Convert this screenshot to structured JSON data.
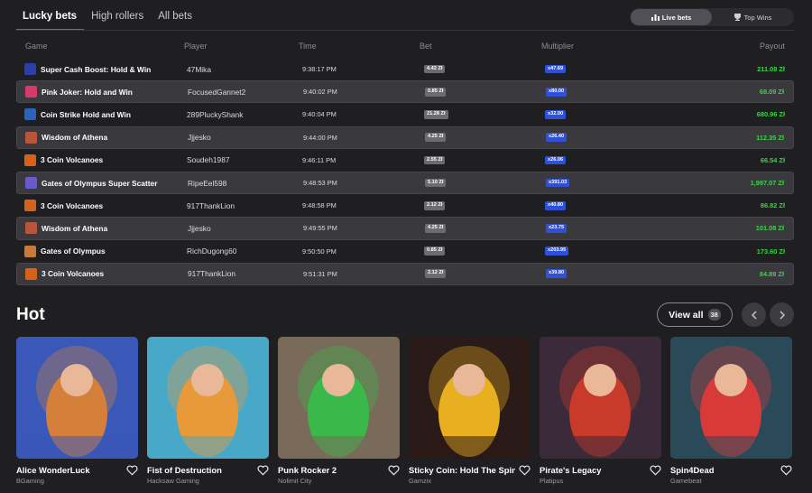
{
  "tabs": [
    "Lucky bets",
    "High rollers",
    "All bets"
  ],
  "toggle": {
    "live": "Live bets",
    "top": "Top Wins"
  },
  "columns": {
    "game": "Game",
    "player": "Player",
    "time": "Time",
    "bet": "Bet",
    "multiplier": "Multiplier",
    "payout": "Payout"
  },
  "rows": [
    {
      "game": "Super Cash Boost: Hold & Win",
      "player": "47Mika",
      "time": "9:38:17 PM",
      "bet": "4.42 Zł",
      "mult": "x47.69",
      "payout": "211.08 Zł",
      "icon_color": "#2a3fa8"
    },
    {
      "game": "Pink Joker: Hold and Win",
      "player": "FocusedGannet2",
      "time": "9:40:02 PM",
      "bet": "0.85 Zł",
      "mult": "x80.00",
      "payout": "68.09 Zł",
      "icon_color": "#d43a6a"
    },
    {
      "game": "Coin Strike Hold and Win",
      "player": "289PluckyShank",
      "time": "9:40:04 PM",
      "bet": "21.28 Zł",
      "mult": "x32.00",
      "payout": "680.96 Zł",
      "icon_color": "#2a63b8"
    },
    {
      "game": "Wisdom of Athena",
      "player": "Jjjesko",
      "time": "9:44:00 PM",
      "bet": "4.25 Zł",
      "mult": "x26.40",
      "payout": "112.35 Zł",
      "icon_color": "#b8553a"
    },
    {
      "game": "3 Coin Volcanoes",
      "player": "Soudeh1987",
      "time": "9:46:11 PM",
      "bet": "2.55 Zł",
      "mult": "x26.06",
      "payout": "66.54 Zł",
      "icon_color": "#d8611a"
    },
    {
      "game": "Gates of Olympus Super Scatter",
      "player": "RipeEel598",
      "time": "9:48:53 PM",
      "bet": "5.10 Zł",
      "mult": "x391.03",
      "payout": "1,997.07 Zł",
      "icon_color": "#6a5ac8"
    },
    {
      "game": "3 Coin Volcanoes",
      "player": "917ThankLion",
      "time": "9:48:58 PM",
      "bet": "2.12 Zł",
      "mult": "x40.80",
      "payout": "86.82 Zł",
      "icon_color": "#d8611a"
    },
    {
      "game": "Wisdom of Athena",
      "player": "Jjjesko",
      "time": "9:49:55 PM",
      "bet": "4.25 Zł",
      "mult": "x23.75",
      "payout": "101.08 Zł",
      "icon_color": "#b8553a"
    },
    {
      "game": "Gates of Olympus",
      "player": "RichDugong60",
      "time": "9:50:50 PM",
      "bet": "0.85 Zł",
      "mult": "x203.95",
      "payout": "173.60 Zł",
      "icon_color": "#c87a3a"
    },
    {
      "game": "3 Coin Volcanoes",
      "player": "917ThankLion",
      "time": "9:51:31 PM",
      "bet": "2.12 Zł",
      "mult": "x39.80",
      "payout": "84.89 Zł",
      "icon_color": "#d8611a"
    }
  ],
  "hot": {
    "title": "Hot",
    "view_all": "View all",
    "count": "38",
    "games": [
      {
        "name": "Alice WonderLuck",
        "provider": "BGaming",
        "bg": "#3a58b8",
        "accent": "#d4803a"
      },
      {
        "name": "Fist of Destruction",
        "provider": "Hacksaw Gaming",
        "bg": "#48a8c8",
        "accent": "#e89a3a"
      },
      {
        "name": "Punk Rocker 2",
        "provider": "Nolimit City",
        "bg": "#7a6a5a",
        "accent": "#3ab84a"
      },
      {
        "name": "Sticky Coin: Hold The Spin",
        "provider": "Gamzix",
        "bg": "#2a1a18",
        "accent": "#e8b020"
      },
      {
        "name": "Pirate's Legacy",
        "provider": "Platipus",
        "bg": "#3a2a3a",
        "accent": "#c83a2a"
      },
      {
        "name": "Spin4Dead",
        "provider": "Gamebeat",
        "bg": "#2a4a5a",
        "accent": "#d83a3a"
      }
    ]
  }
}
